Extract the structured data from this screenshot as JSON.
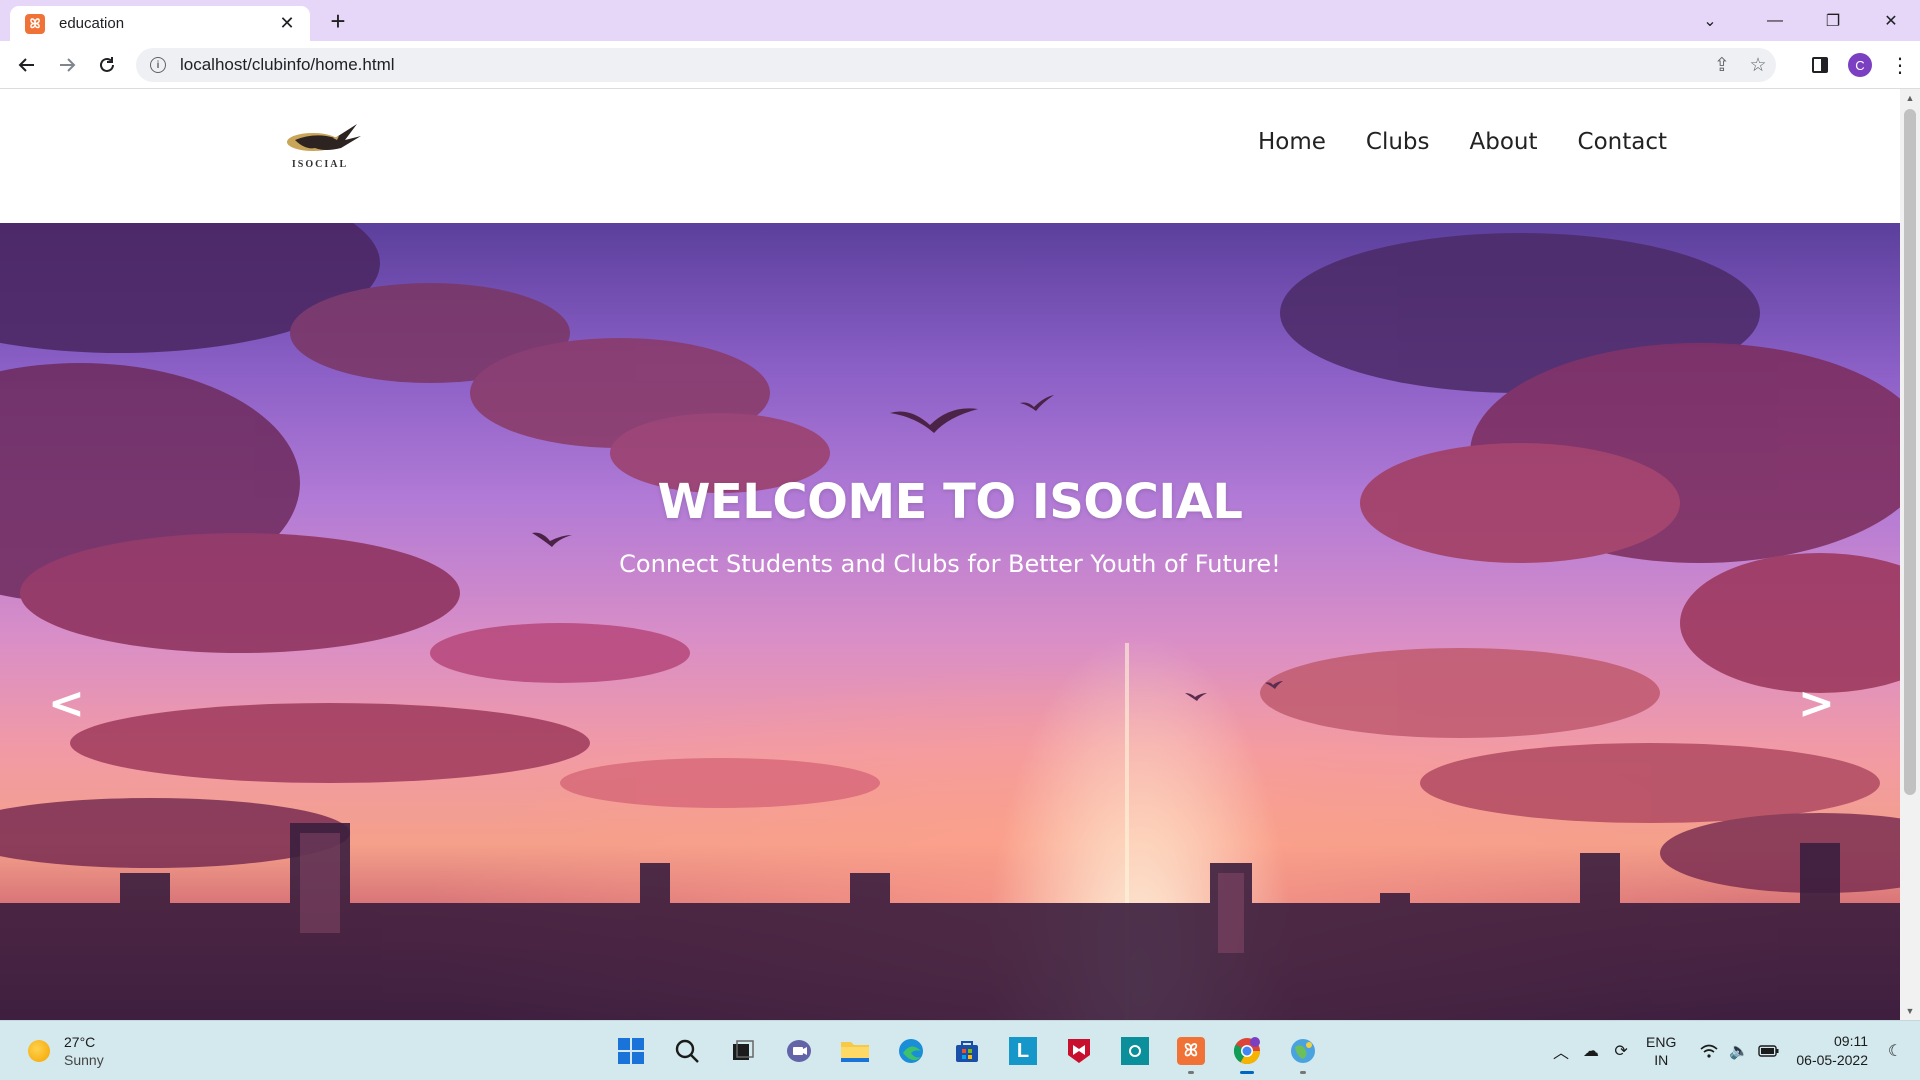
{
  "browser": {
    "tab_title": "education",
    "tab_favicon": "xampp-icon",
    "new_tab": "+",
    "url": "localhost/clubinfo/home.html",
    "profile_initial": "C",
    "window_controls": {
      "tab_search": "⌄",
      "minimize": "—",
      "restore": "❐",
      "close": "✕"
    }
  },
  "site": {
    "logo_text": "ISOCIAL",
    "nav": [
      "Home",
      "Clubs",
      "About",
      "Contact"
    ]
  },
  "hero": {
    "title": "WELCOME TO ISOCIAL",
    "subtitle": "Connect Students and Clubs for Better Youth of Future!",
    "prev": "<",
    "next": ">"
  },
  "taskbar": {
    "weather_temp": "27°C",
    "weather_cond": "Sunny",
    "language": "ENG",
    "region": "IN",
    "time": "09:11",
    "date": "06-05-2022"
  },
  "colors": {
    "tab_strip": "#e6d7f8",
    "taskbar": "#d3e9ee",
    "profile": "#7b3fc2"
  }
}
